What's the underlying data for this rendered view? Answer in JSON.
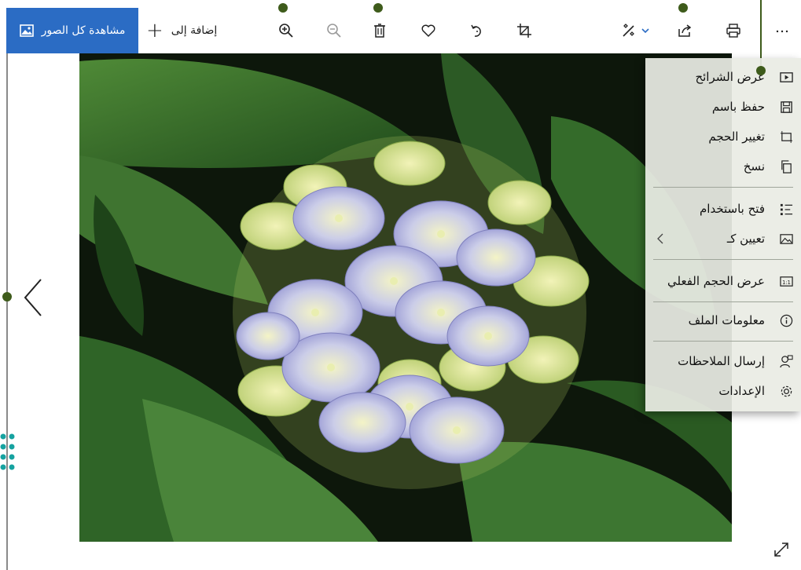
{
  "toolbar": {
    "see_all_label": "مشاهدة كل الصور",
    "add_to_label": "إضافة إلى",
    "icons": [
      "zoom-in-icon",
      "zoom-out-icon",
      "delete-icon",
      "favorite-icon",
      "rotate-icon",
      "crop-icon",
      "edit-icon",
      "share-icon",
      "print-icon",
      "more-icon"
    ]
  },
  "menu": {
    "items": [
      {
        "label": "عرض الشرائح",
        "icon": "slideshow-icon"
      },
      {
        "label": "حفظ باسم",
        "icon": "save-icon"
      },
      {
        "label": "تغيير الحجم",
        "icon": "resize-icon"
      },
      {
        "label": "نسخ",
        "icon": "copy-icon"
      },
      {
        "label": "فتح باستخدام",
        "icon": "open-with-icon"
      },
      {
        "label": "تعيين كـ",
        "icon": "set-as-icon"
      },
      {
        "label": "عرض الحجم الفعلي",
        "icon": "actual-size-icon"
      },
      {
        "label": "معلومات الملف",
        "icon": "info-icon"
      },
      {
        "label": "إرسال الملاحظات",
        "icon": "feedback-icon"
      },
      {
        "label": "الإعدادات",
        "icon": "settings-icon"
      }
    ]
  },
  "colors": {
    "accent": "#2b6cc4",
    "callout": "#3e5b1b"
  }
}
